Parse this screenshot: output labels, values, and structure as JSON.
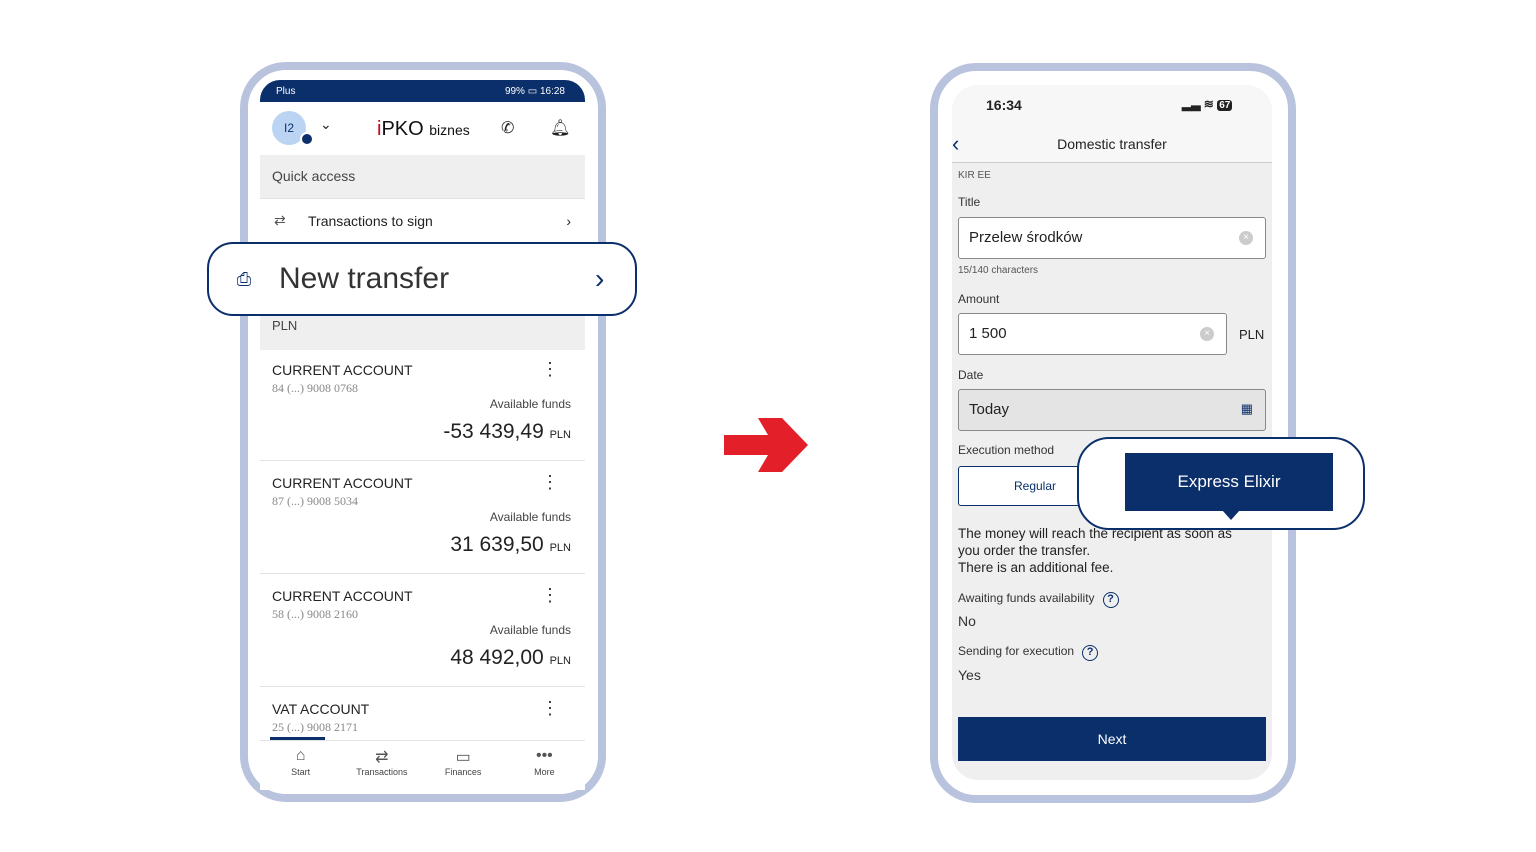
{
  "left_phone": {
    "status": {
      "carrier": "Plus",
      "battery": "99%",
      "time": "16:28"
    },
    "header": {
      "avatar": "I2",
      "logo_main": "PKO",
      "logo_sub": "biznes"
    },
    "quick_access": "Quick access",
    "transactions_to_sign": "Transactions to sign",
    "new_transfer": "New transfer",
    "currency_section": "PLN",
    "accounts": [
      {
        "type": "CURRENT ACCOUNT",
        "number": "84 (...) 9008 0768",
        "funds_label": "Available funds",
        "amount": "-53 439,49",
        "currency": "PLN"
      },
      {
        "type": "CURRENT ACCOUNT",
        "number": "87 (...) 9008 5034",
        "funds_label": "Available funds",
        "amount": "31 639,50",
        "currency": "PLN"
      },
      {
        "type": "CURRENT ACCOUNT",
        "number": "58 (...) 9008 2160",
        "funds_label": "Available funds",
        "amount": "48 492,00",
        "currency": "PLN"
      },
      {
        "type": "VAT ACCOUNT",
        "number": "25 (...) 9008 2171"
      }
    ],
    "nav": [
      {
        "label": "Start",
        "icon": "home-icon"
      },
      {
        "label": "Transactions",
        "icon": "transfer-icon"
      },
      {
        "label": "Finances",
        "icon": "wallet-icon"
      },
      {
        "label": "More",
        "icon": "more-icon"
      }
    ]
  },
  "right_phone": {
    "status": {
      "time": "16:34",
      "battery": "67"
    },
    "header": {
      "title": "Domestic transfer"
    },
    "sender": "KIR EE",
    "title_label": "Title",
    "title_value": "Przelew środków",
    "title_counter": "15/140 characters",
    "amount_label": "Amount",
    "amount_value": "1 500",
    "amount_currency": "PLN",
    "date_label": "Date",
    "date_value": "Today",
    "execution_label": "Execution method",
    "method_regular": "Regular",
    "method_express": "Express Elixir",
    "info_line1": "The money will reach the recipient as soon as",
    "info_line2": "you order the transfer.",
    "info_line3": "There is an additional fee.",
    "awaiting_label": "Awaiting funds availability",
    "awaiting_value": "No",
    "sending_label": "Sending for execution",
    "sending_value": "Yes",
    "next": "Next"
  },
  "colors": {
    "brand_navy": "#0b2f6b",
    "frame": "#b9c3dd",
    "arrow": "#e3202a"
  }
}
